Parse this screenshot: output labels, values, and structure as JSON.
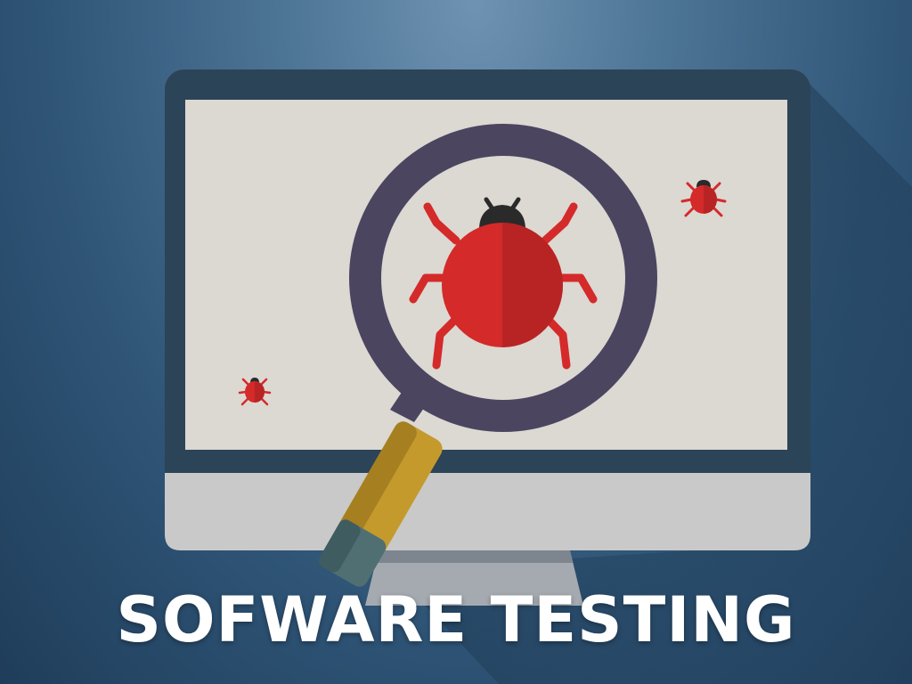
{
  "title": "SOFWARE TESTING",
  "colors": {
    "background": "#3a5f81",
    "monitor_frame": "#2c4457",
    "screen": "#dcd8d2",
    "monitor_base": "#c9c9c9",
    "lens_ring": "#4b4560",
    "handle": "#c49a2c",
    "bug_body": "#d42a2a",
    "bug_head": "#2a2a2a"
  },
  "icons": [
    "monitor-icon",
    "magnifying-glass-icon",
    "bug-icon",
    "small-bug-icon"
  ]
}
